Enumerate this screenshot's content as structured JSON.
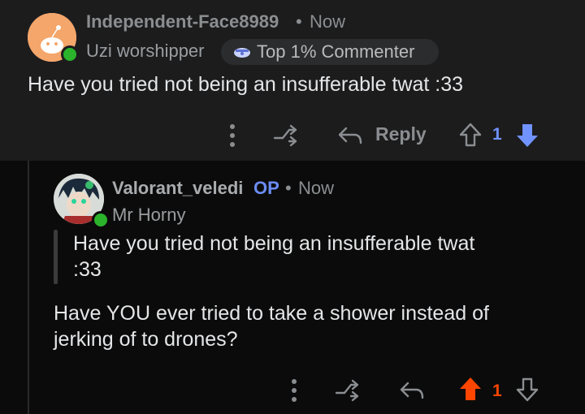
{
  "parent_comment": {
    "username": "Independent-Face8989",
    "separator": "•",
    "time": "Now",
    "flair": "Uzi worshipper",
    "badge": "Top 1% Commenter",
    "text": "Have you tried not being an insufferable twat :33",
    "actions": {
      "reply_label": "Reply",
      "vote_count": "1"
    },
    "colors": {
      "downvote_active": "#7193ff"
    },
    "icons": [
      "more-dots-icon",
      "share-icon",
      "reply-arrow-icon",
      "upvote-icon",
      "downvote-icon"
    ]
  },
  "reply_comment": {
    "username": "Valorant_veledi",
    "op_tag": "OP",
    "separator": "•",
    "time": "Now",
    "flair": "Mr Horny",
    "quote_line1": "Have you tried not being an insufferable twat",
    "quote_line2": ":33",
    "text_line1": "Have YOU ever tried to take a shower instead of",
    "text_line2": "jerking of to drones?",
    "actions": {
      "vote_count": "1"
    },
    "colors": {
      "upvote_active": "#ff4500"
    },
    "icons": [
      "more-dots-icon",
      "share-icon",
      "reply-arrow-icon",
      "upvote-icon",
      "downvote-icon"
    ]
  }
}
